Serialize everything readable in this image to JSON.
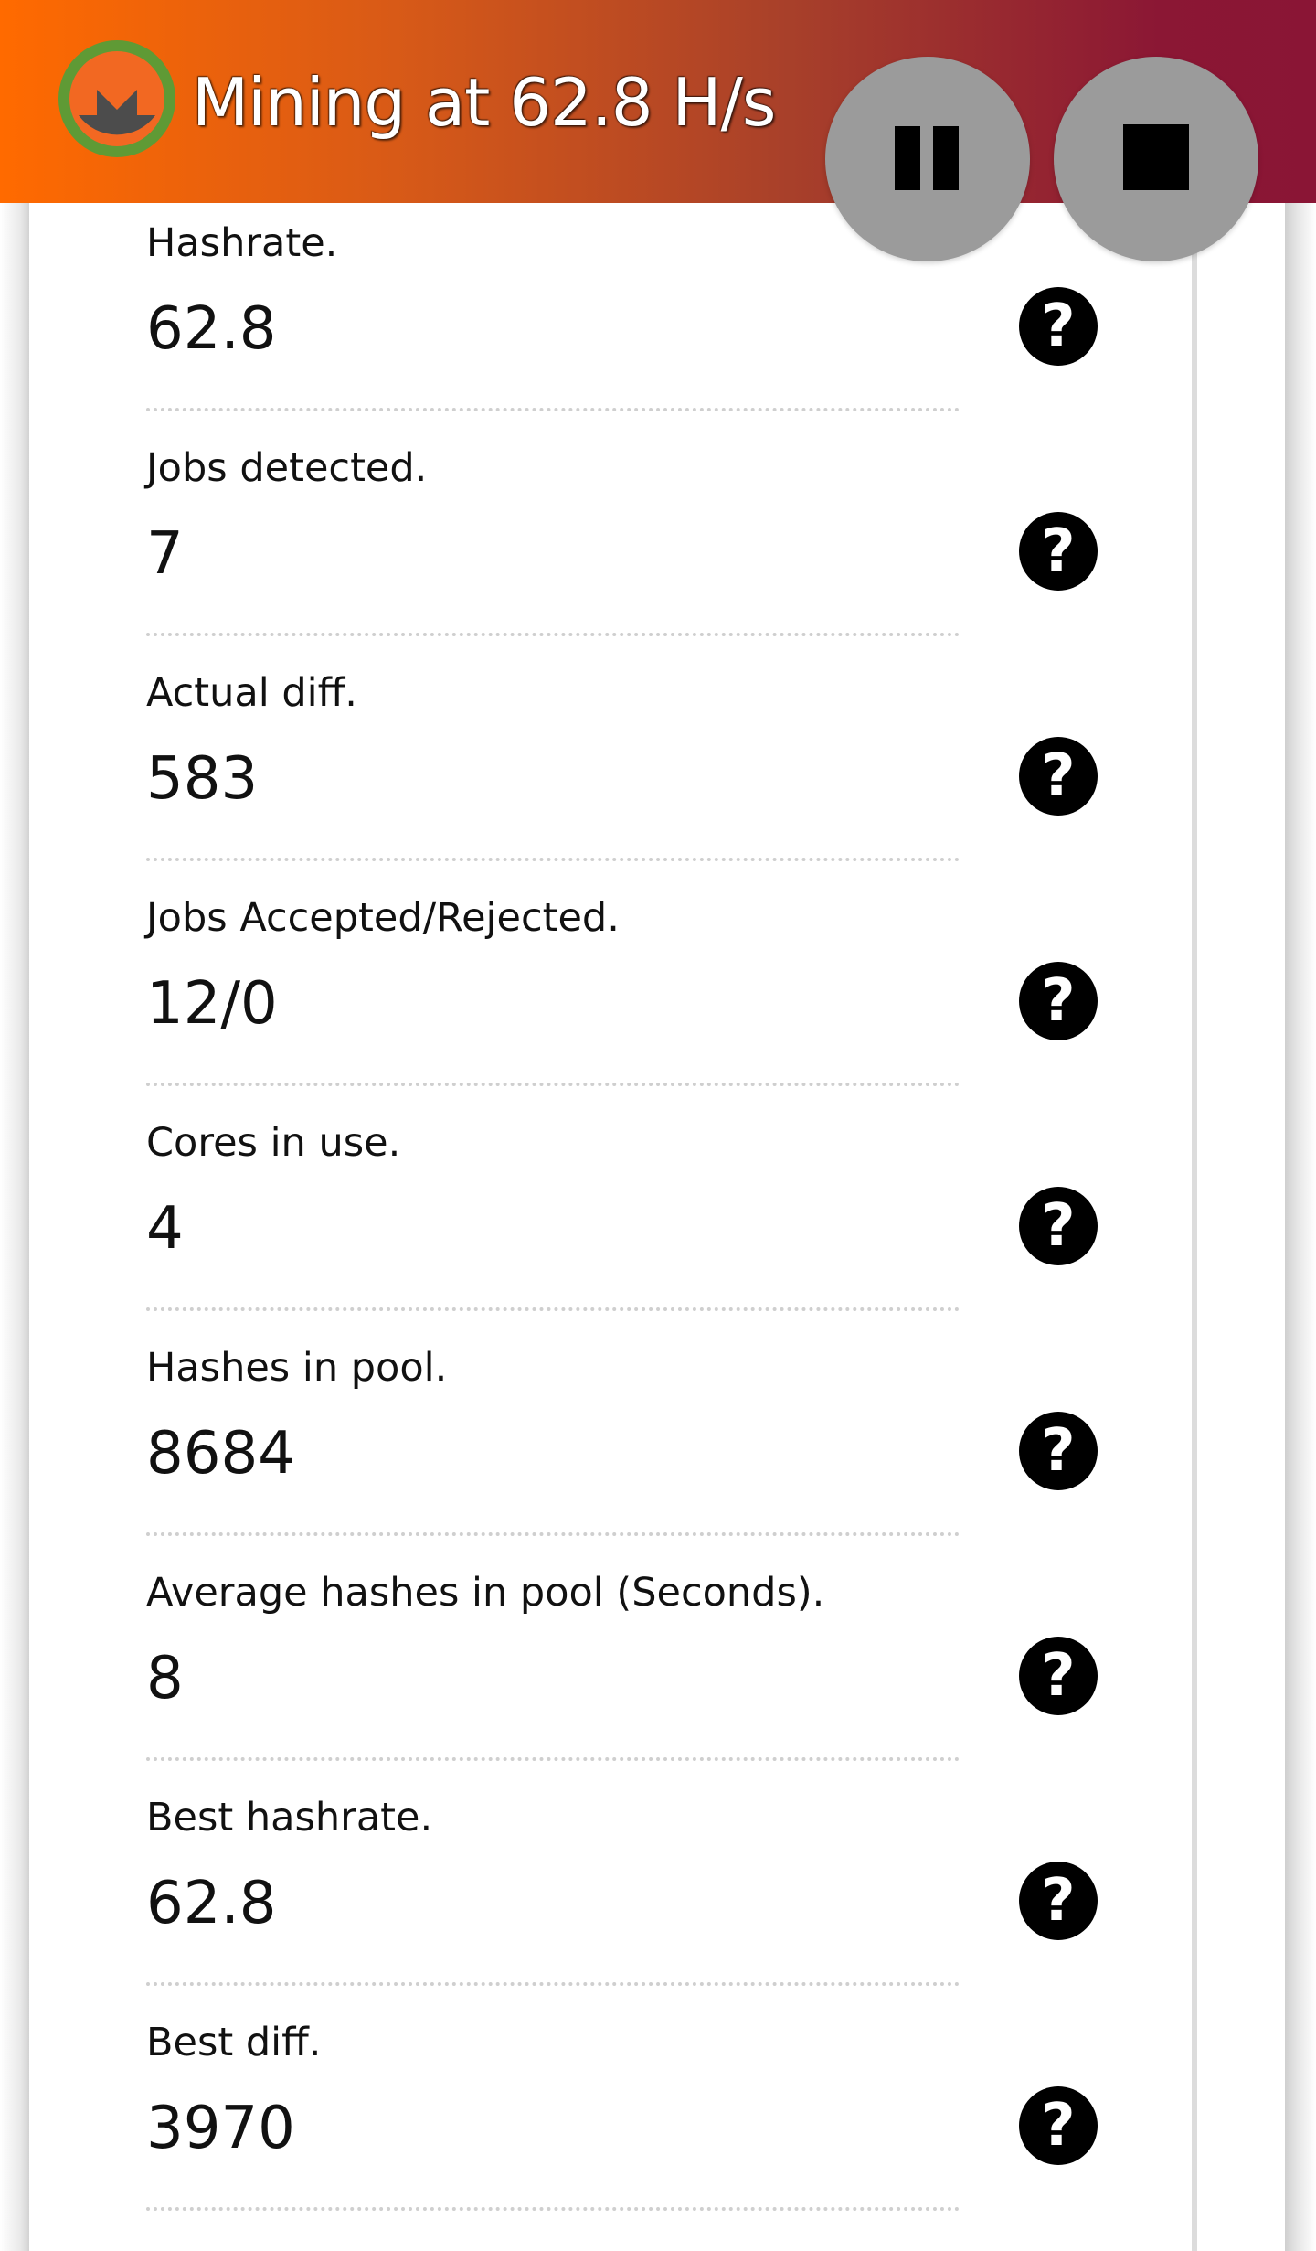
{
  "header": {
    "title": "Mining at 62.8 H/s",
    "logo_icon": "monero-logo-icon",
    "gradient_colors": [
      "#ff6a00",
      "#8b1734"
    ]
  },
  "controls": {
    "pause_icon": "pause-icon",
    "stop_icon": "stop-icon",
    "button_color": "#9b9b9b"
  },
  "stats": [
    {
      "label": "Hashrate.",
      "value": "62.8",
      "help": "?"
    },
    {
      "label": "Jobs detected.",
      "value": "7",
      "help": "?"
    },
    {
      "label": "Actual diff.",
      "value": "583",
      "help": "?"
    },
    {
      "label": "Jobs Accepted/Rejected.",
      "value": "12/0",
      "help": "?"
    },
    {
      "label": "Cores in use.",
      "value": "4",
      "help": "?"
    },
    {
      "label": "Hashes in pool.",
      "value": "8684",
      "help": "?"
    },
    {
      "label": "Average hashes in pool (Seconds).",
      "value": "8",
      "help": "?"
    },
    {
      "label": "Best hashrate.",
      "value": "62.8",
      "help": "?"
    },
    {
      "label": "Best diff.",
      "value": "3970",
      "help": "?"
    }
  ]
}
